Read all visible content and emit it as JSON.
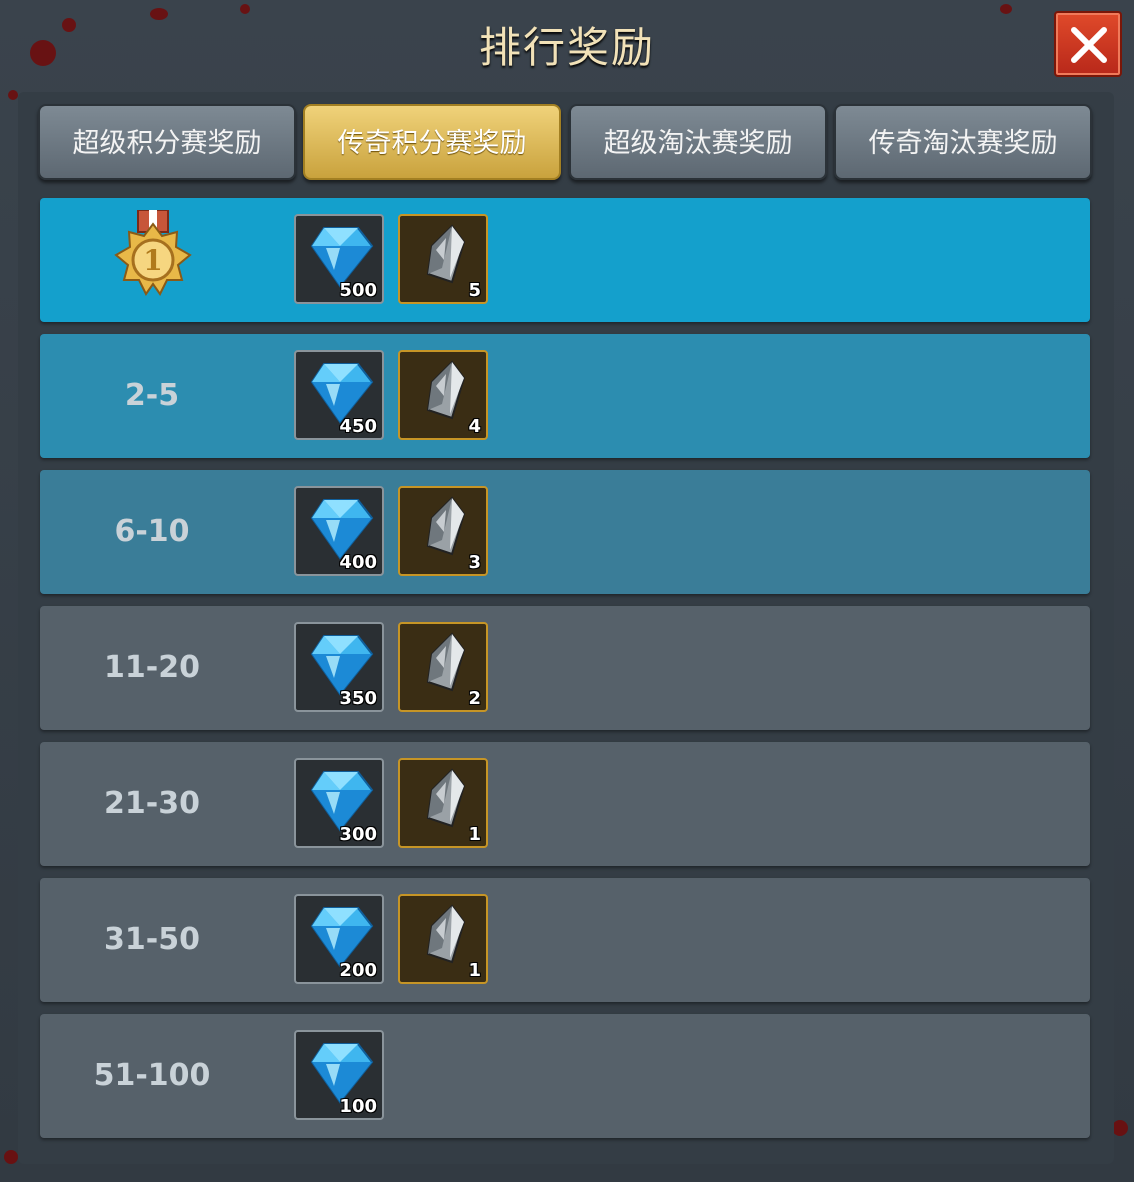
{
  "title": "排行奖励",
  "tabs": [
    {
      "label": "超级积分赛奖励",
      "active": false
    },
    {
      "label": "传奇积分赛奖励",
      "active": true
    },
    {
      "label": "超级淘汰赛奖励",
      "active": false
    },
    {
      "label": "传奇淘汰赛奖励",
      "active": false
    }
  ],
  "rows": [
    {
      "rank": "1",
      "gem": "500",
      "crystal": "5",
      "color": "#14a0cc"
    },
    {
      "rank": "2-5",
      "gem": "450",
      "crystal": "4",
      "color": "#2c8db0"
    },
    {
      "rank": "6-10",
      "gem": "400",
      "crystal": "3",
      "color": "#3a7d98"
    },
    {
      "rank": "11-20",
      "gem": "350",
      "crystal": "2",
      "color": "#56616a"
    },
    {
      "rank": "21-30",
      "gem": "300",
      "crystal": "1",
      "color": "#56616a"
    },
    {
      "rank": "31-50",
      "gem": "200",
      "crystal": "1",
      "color": "#56616a"
    },
    {
      "rank": "51-100",
      "gem": "100",
      "crystal": null,
      "color": "#56616a"
    }
  ],
  "icons": {
    "close": "close-icon",
    "medal": "gold-medal-icon",
    "gem": "diamond-icon",
    "crystal": "crystal-shard-icon"
  }
}
